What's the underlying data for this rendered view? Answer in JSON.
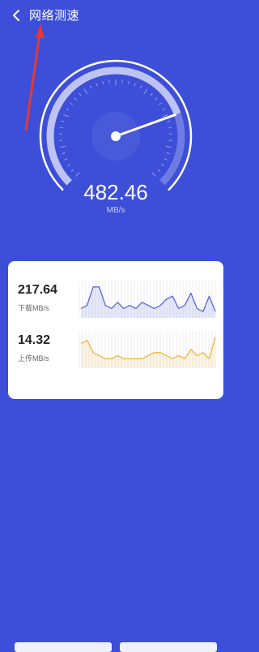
{
  "header": {
    "title": "网络测速",
    "back_icon": "chevron-left-icon"
  },
  "gauge": {
    "value": "482.46",
    "unit": "MB/s",
    "level": 0.76
  },
  "download": {
    "value": "217.64",
    "label": "下载MB/s",
    "color": "#5b67d8",
    "series": [
      2,
      3,
      9,
      9,
      3,
      2,
      4,
      2,
      3,
      2,
      4,
      3,
      2,
      3,
      5,
      6,
      2,
      3,
      7,
      2,
      1,
      6,
      1
    ]
  },
  "upload": {
    "value": "14.32",
    "label": "上传MB/s",
    "color": "#f0b43c",
    "series": [
      7,
      8,
      4,
      3,
      2,
      2,
      3,
      2,
      2,
      2,
      2,
      3,
      4,
      4,
      3,
      2,
      3,
      2,
      5,
      3,
      4,
      2,
      9
    ]
  },
  "colors": {
    "background": "#3d4fd8",
    "card": "#ffffff",
    "annotation": "#e53935"
  }
}
